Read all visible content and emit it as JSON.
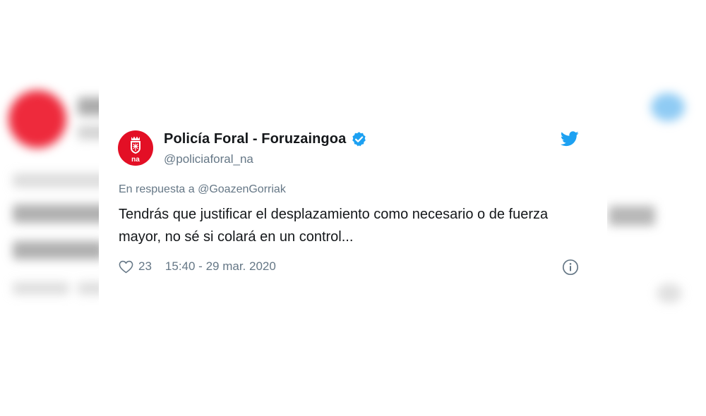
{
  "tweet": {
    "display_name": "Policía Foral - Foruzaingoa",
    "handle": "@policiaforal_na",
    "avatar_text": "na",
    "reply_prefix": "En respuesta a",
    "reply_handle": "@GoazenGorriak",
    "text": "Tendrás que justificar el desplazamiento como necesario o de fuerza mayor, no sé si colará en un control...",
    "like_count": "23",
    "timestamp": "15:40 - 29 mar. 2020"
  },
  "icons": {
    "verified": "verified-badge-icon",
    "brand": "twitter-bird-icon",
    "like": "heart-icon",
    "info": "info-icon"
  },
  "colors": {
    "avatar_red": "#e30f25",
    "twitter_blue": "#1da1f2",
    "text_primary": "#14171a",
    "text_secondary": "#657786"
  }
}
